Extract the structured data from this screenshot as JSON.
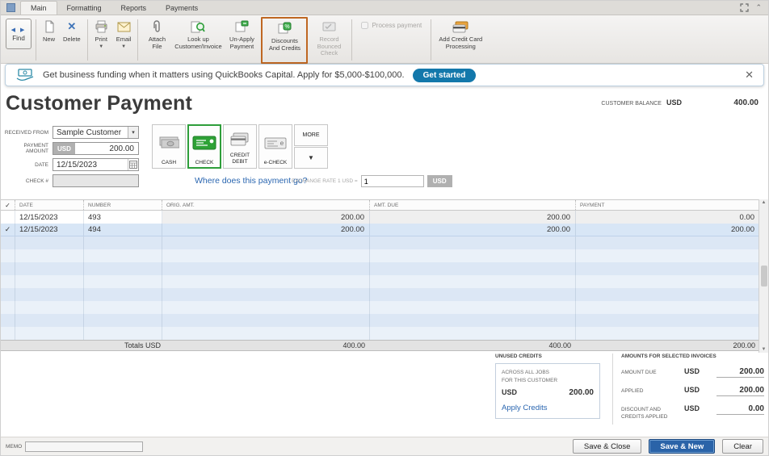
{
  "window": {
    "tabs": [
      "Main",
      "Formatting",
      "Reports",
      "Payments"
    ],
    "active_tab": "Main"
  },
  "toolbar": {
    "find": "Find",
    "new": "New",
    "delete": "Delete",
    "print": "Print",
    "email": "Email",
    "attach_file": "Attach File",
    "lookup": "Look up Customer/Invoice",
    "unapply": "Un-Apply Payment",
    "discounts": "Discounts And Credits",
    "record_bounced": "Record Bounced Check",
    "process_payment": "Process payment",
    "add_cc": "Add Credit Card Processing"
  },
  "banner": {
    "text": "Get business funding when it matters using QuickBooks Capital. Apply for $5,000-$100,000.",
    "button": "Get started"
  },
  "page": {
    "title": "Customer Payment",
    "customer_balance_label": "CUSTOMER BALANCE",
    "customer_balance_currency": "USD",
    "customer_balance_value": "400.00"
  },
  "form": {
    "received_from_label": "RECEIVED FROM",
    "received_from_value": "Sample Customer",
    "payment_amount_label": "PAYMENT AMOUNT",
    "payment_currency": "USD",
    "payment_amount": "200.00",
    "date_label": "DATE",
    "date_value": "12/15/2023",
    "check_label": "CHECK #",
    "where_link": "Where does this payment go?",
    "exchange_rate_label": "EXCHANGE RATE 1 USD =",
    "exchange_rate_value": "1",
    "exchange_rate_currency": "USD"
  },
  "methods": {
    "cash": "CASH",
    "check": "CHECK",
    "credit": "CREDIT DEBIT",
    "echeck": "e-CHECK",
    "more": "MORE"
  },
  "table": {
    "columns": [
      "DATE",
      "NUMBER",
      "ORIG. AMT.",
      "AMT. DUE",
      "PAYMENT"
    ],
    "rows": [
      {
        "checked": "",
        "date": "12/15/2023",
        "number": "493",
        "orig": "200.00",
        "due": "200.00",
        "payment": "0.00"
      },
      {
        "checked": "✓",
        "date": "12/15/2023",
        "number": "494",
        "orig": "200.00",
        "due": "200.00",
        "payment": "200.00"
      }
    ],
    "totals_label": "Totals USD",
    "totals": {
      "orig": "400.00",
      "due": "400.00",
      "payment": "200.00"
    }
  },
  "unused_credits": {
    "title": "UNUSED CREDITS",
    "line1": "ACROSS ALL JOBS",
    "line2": "FOR THIS CUSTOMER",
    "currency": "USD",
    "amount": "200.00",
    "link": "Apply Credits"
  },
  "selected_invoices": {
    "title": "AMOUNTS FOR SELECTED INVOICES",
    "rows": [
      {
        "label": "AMOUNT DUE",
        "currency": "USD",
        "value": "200.00"
      },
      {
        "label": "APPLIED",
        "currency": "USD",
        "value": "200.00"
      },
      {
        "label": "DISCOUNT AND CREDITS APPLIED",
        "currency": "USD",
        "value": "0.00"
      }
    ]
  },
  "footer": {
    "memo_label": "MEMO",
    "save_close": "Save & Close",
    "save_new": "Save & New",
    "clear": "Clear"
  },
  "icons": {
    "check": "✓",
    "caret_down": "▾",
    "triangle_down": "▼",
    "close": "✕",
    "up": "▲",
    "down": "▼",
    "find_arrows": "◀ ▶",
    "collapse": "⌃"
  },
  "colors": {
    "qb_green": "#2e9e3a",
    "banner_button": "#1378ab",
    "primary_button": "#2a63a8",
    "highlight_orange": "#bf6722",
    "selected_row": "#d8e6f6"
  }
}
